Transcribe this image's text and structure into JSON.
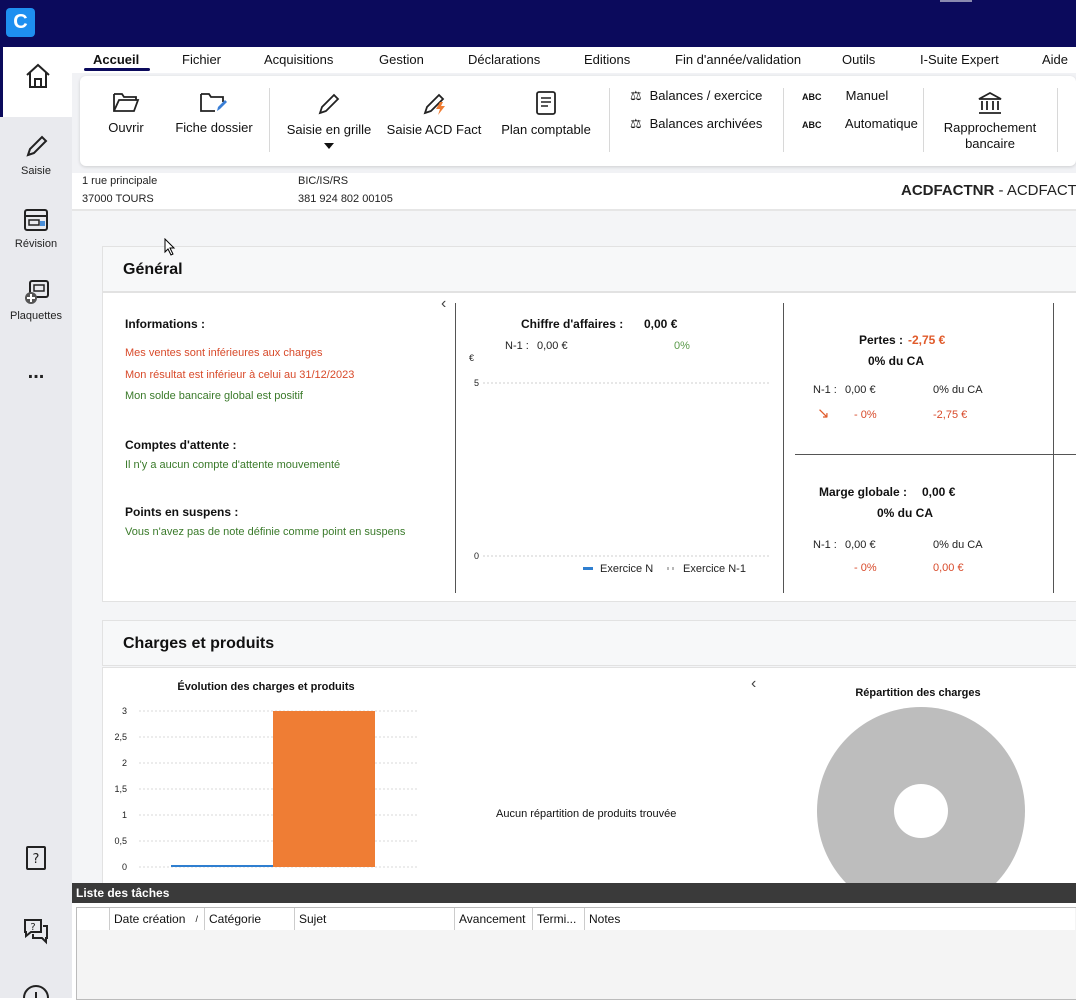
{
  "app": {
    "logo_letter": "C"
  },
  "nav": {
    "items": [
      {
        "label": "",
        "icon": "home-icon"
      },
      {
        "label": "Saisie",
        "icon": "pencil-icon"
      },
      {
        "label": "Révision",
        "icon": "revision-icon"
      },
      {
        "label": "Plaquettes",
        "icon": "plaquettes-icon"
      },
      {
        "label": "...",
        "icon": "more-icon"
      }
    ],
    "bottom": [
      {
        "icon": "help-book-icon"
      },
      {
        "icon": "chat-help-icon"
      },
      {
        "icon": "info-icon"
      }
    ]
  },
  "menu": {
    "items": [
      "Accueil",
      "Fichier",
      "Acquisitions",
      "Gestion",
      "Déclarations",
      "Editions",
      "Fin d'année/validation",
      "Outils",
      "I-Suite Expert",
      "Aide"
    ],
    "active": "Accueil"
  },
  "ribbon": {
    "ouvrir": "Ouvrir",
    "fiche_dossier": "Fiche dossier",
    "saisie_grille": "Saisie en grille",
    "saisie_acd_fact": "Saisie ACD Fact",
    "plan_comptable": "Plan comptable",
    "balances_exercice": "Balances / exercice",
    "balances_archivees": "Balances archivées",
    "abc": "ABC",
    "manuel": "Manuel",
    "automatique": "Automatique",
    "rapprochement_1": "Rapprochement",
    "rapprochement_2": "bancaire"
  },
  "dossier": {
    "address1": "1 rue principale",
    "address2": "37000 TOURS",
    "regime": "BIC/IS/RS",
    "siret": "381 924 802 00105",
    "code": "ACDFACTNR",
    "name_suffix": " - ACDFACT"
  },
  "general": {
    "title": "Général",
    "informations_label": "Informations :",
    "info_lines": [
      {
        "text": "Mes ventes sont inférieures aux charges",
        "status": "red"
      },
      {
        "text": "Mon résultat est inférieur à celui au 31/12/2023",
        "status": "red"
      },
      {
        "text": "Mon solde bancaire global est positif",
        "status": "green"
      }
    ],
    "attente_label": "Comptes d'attente :",
    "attente_text": "Il n'y a aucun compte d'attente mouvementé",
    "suspens_label": "Points en suspens :",
    "suspens_text": "Vous n'avez pas de note définie comme point en suspens",
    "ca": {
      "label": "Chiffre d'affaires :",
      "value": "0,00 €",
      "n1_label": "N-1 :",
      "n1_value": "0,00 €",
      "n1_pct": "0%"
    },
    "pertes": {
      "label": "Pertes :",
      "value": "-2,75 €",
      "pct_ca": "0% du CA",
      "n1_label": "N-1 :",
      "n1_value": "0,00 €",
      "n1_pct_ca": "0% du CA",
      "delta_pct": "- 0%",
      "delta_value": "-2,75 €"
    },
    "marge": {
      "label": "Marge globale :",
      "value": "0,00 €",
      "pct_ca": "0% du CA",
      "n1_label": "N-1 :",
      "n1_value": "0,00 €",
      "n1_pct_ca": "0% du CA",
      "delta_pct": "- 0%",
      "delta_value": "0,00 €"
    }
  },
  "charges_produits": {
    "title": "Charges et produits",
    "no_produits_text": "Aucun répartition de produits trouvée",
    "pie_title": "Répartition des charges"
  },
  "chart_data": [
    {
      "type": "line",
      "ylabel": "€",
      "ylim": [
        0,
        5
      ],
      "yticks": [
        "5",
        "0"
      ],
      "series": [
        {
          "name": "Exercice N",
          "color": "#2f7fd0",
          "values": []
        },
        {
          "name": "Exercice N-1",
          "color": "#b8b8b8",
          "values": []
        }
      ]
    },
    {
      "type": "bar",
      "title": "Évolution des charges et produits",
      "ylim": [
        0,
        3
      ],
      "yticks": [
        "3",
        "2,5",
        "2",
        "1,5",
        "1",
        "0,5",
        "0"
      ],
      "series": [
        {
          "values": [
            0
          ],
          "color": "#2f7fd0"
        },
        {
          "values": [
            3
          ],
          "color": "#ef7d34"
        }
      ]
    },
    {
      "type": "pie",
      "title": "Répartition des charges",
      "slices": [
        {
          "value": 100,
          "color": "#bdbdbd"
        }
      ]
    }
  ],
  "tasks": {
    "title": "Liste des tâches",
    "columns": [
      "",
      "Date création",
      "Catégorie",
      "Sujet",
      "Avancement",
      "Termi...",
      "Notes"
    ]
  }
}
